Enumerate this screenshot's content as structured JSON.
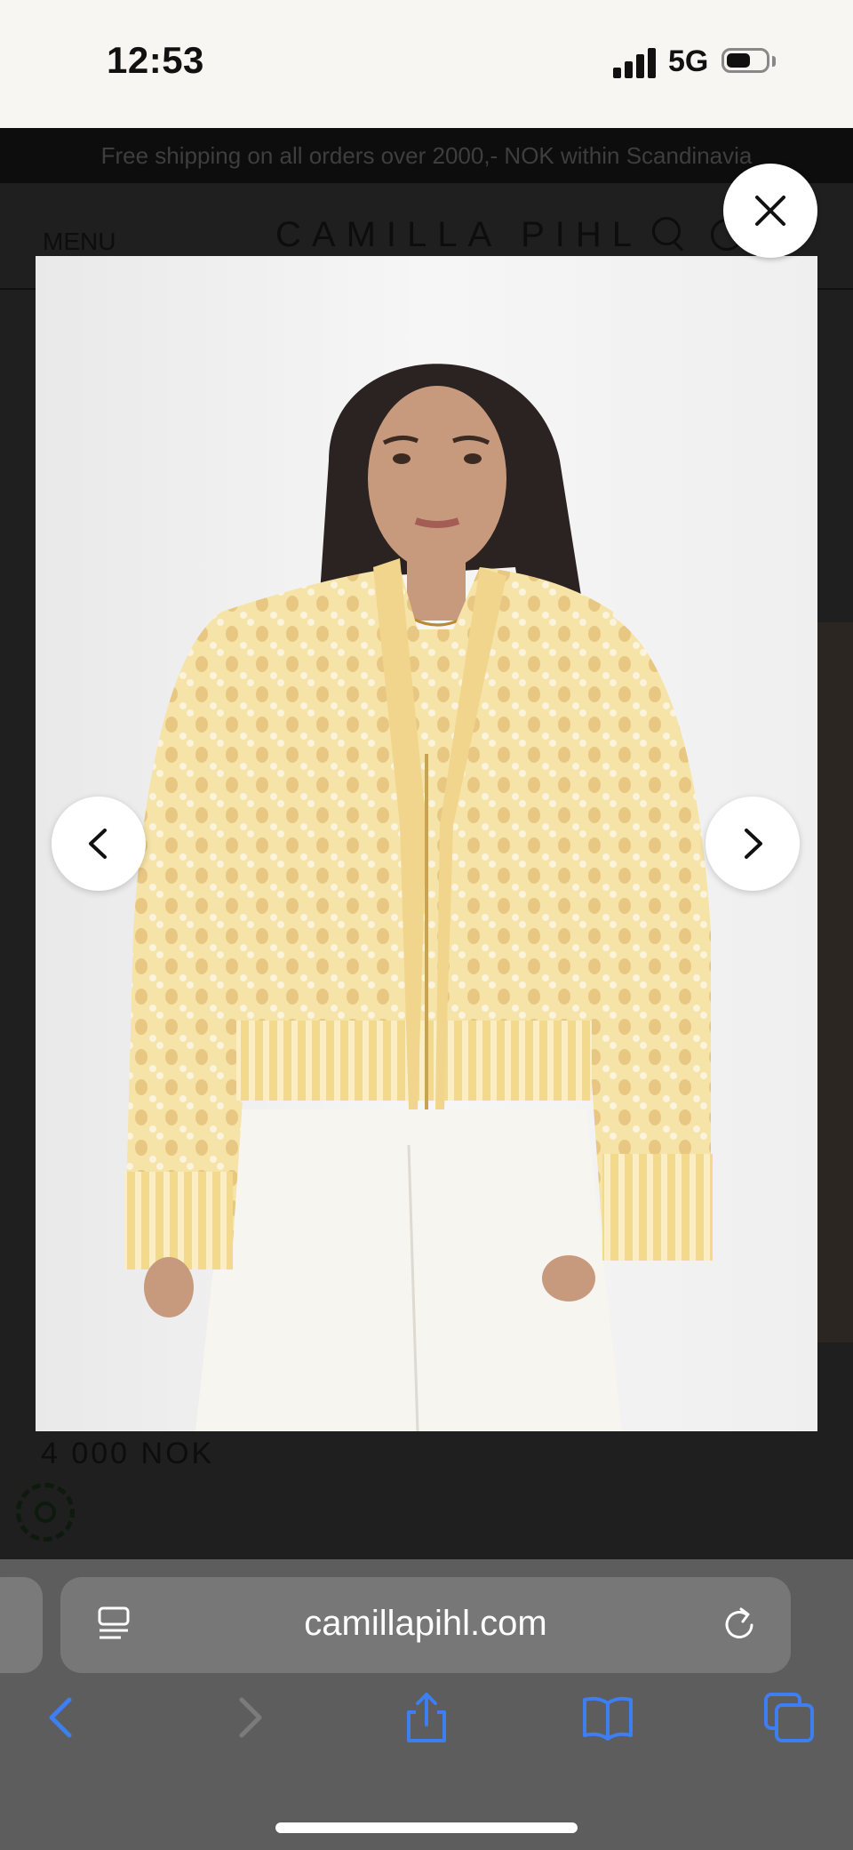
{
  "status_bar": {
    "time": "12:53",
    "network": "5G"
  },
  "page": {
    "promo_text": "Free shipping on all orders over 2000,- NOK within Scandinavia",
    "menu_label": "MENU",
    "brand": "CAMILLA PIHL",
    "price": "4 000 NOK"
  },
  "lightbox": {
    "image_alt": "Model wearing a yellow and cream open-knit mohair zip cardigan with white jeans",
    "close_icon": "close-icon",
    "prev_icon": "chevron-left-icon",
    "next_icon": "chevron-right-icon"
  },
  "browser": {
    "url": "camillapihl.com",
    "toolbar_icons": [
      "back-icon",
      "forward-icon",
      "share-icon",
      "bookmarks-icon",
      "tabs-icon"
    ],
    "accent": "#3d7ef0"
  }
}
